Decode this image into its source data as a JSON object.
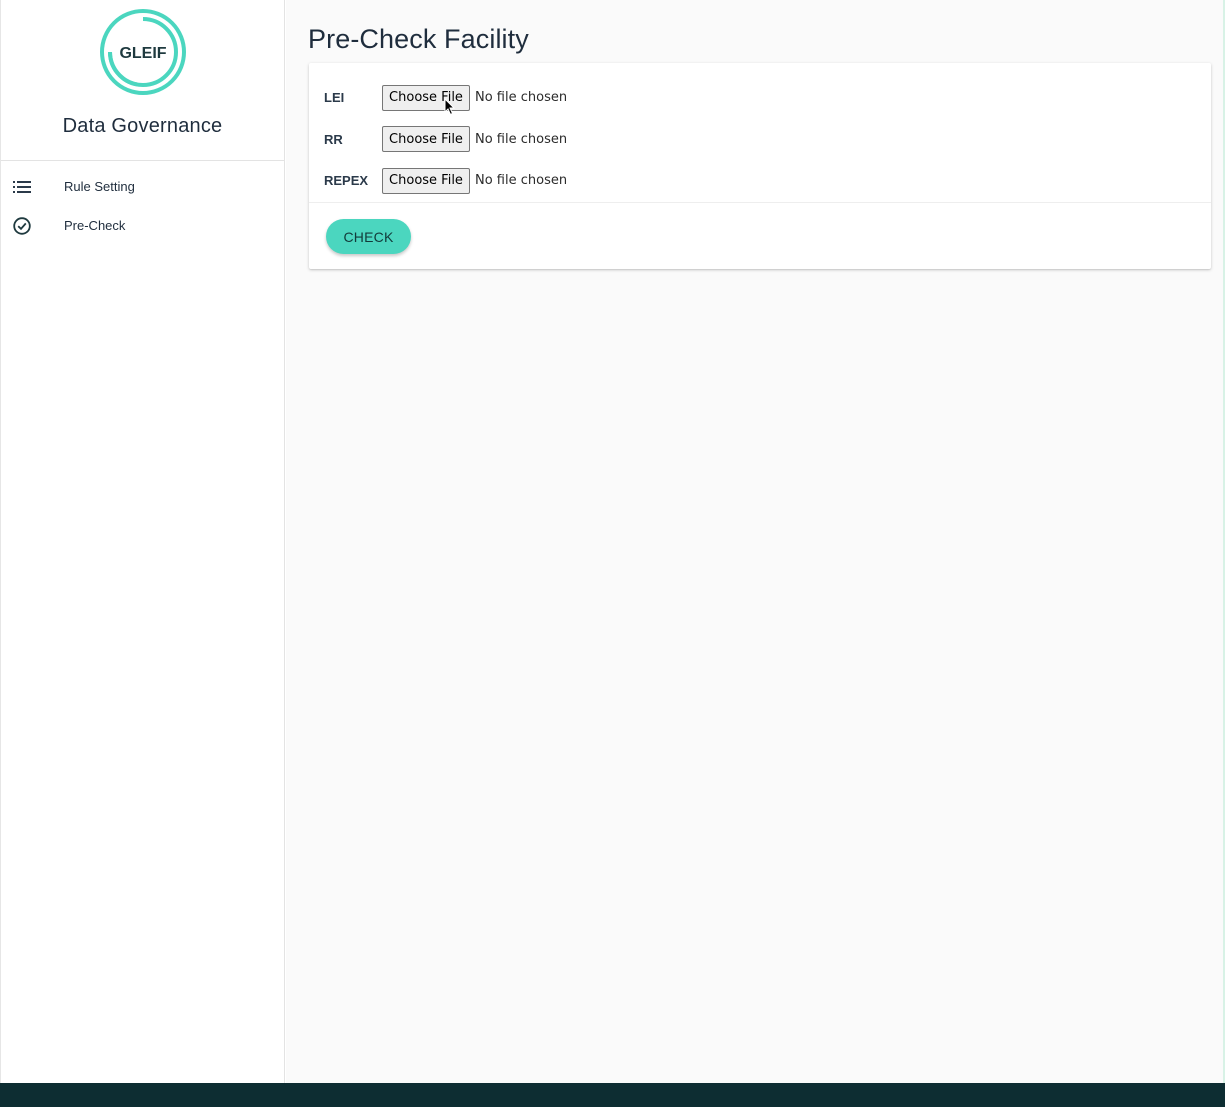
{
  "brand": {
    "logo_text": "GLEIF",
    "title": "Data Governance",
    "accent_color": "#4bd6bf"
  },
  "sidebar": {
    "items": [
      {
        "label": "Rule Setting",
        "icon": "list-icon"
      },
      {
        "label": "Pre-Check",
        "icon": "check-circle-icon"
      }
    ]
  },
  "main": {
    "title": "Pre-Check Facility",
    "file_inputs": [
      {
        "label": "LEI",
        "button": "Choose File",
        "status": "No file chosen"
      },
      {
        "label": "RR",
        "button": "Choose File",
        "status": "No file chosen"
      },
      {
        "label": "REPEX",
        "button": "Choose File",
        "status": "No file chosen"
      }
    ],
    "check_button": "CHECK"
  },
  "footer": {
    "color": "#0d2d32"
  }
}
